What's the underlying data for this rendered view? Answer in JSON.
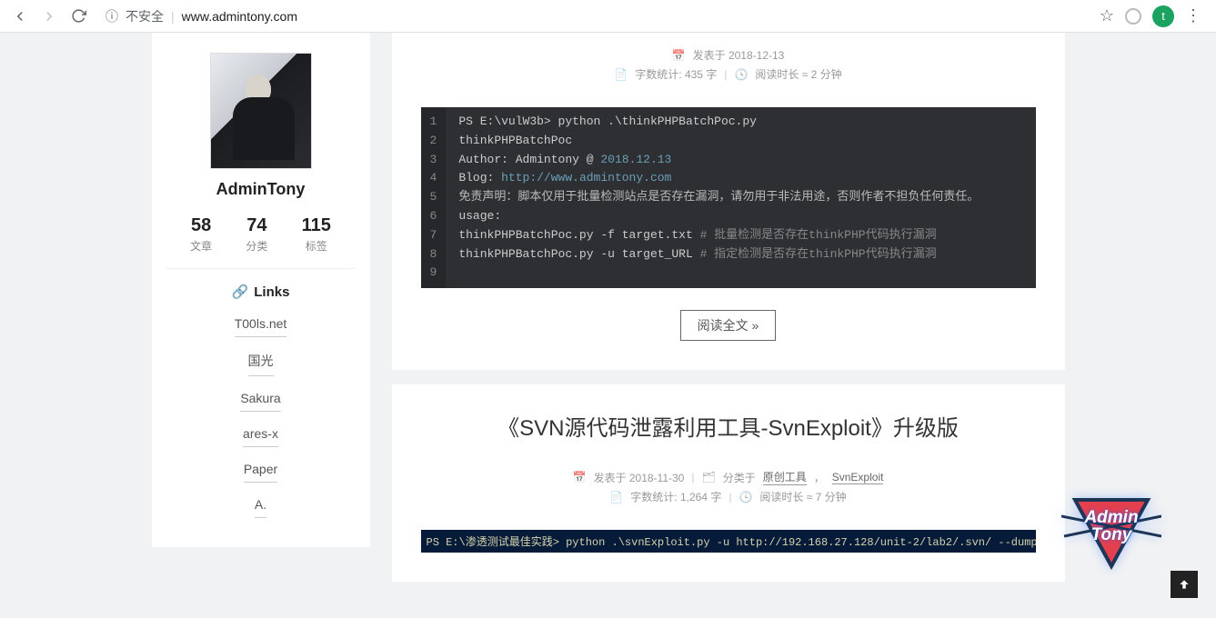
{
  "browser": {
    "insecure_label": "不安全",
    "url": "www.admintony.com",
    "avatar_letter": "t"
  },
  "sidebar": {
    "title": "AdminTony",
    "stats": [
      {
        "num": "58",
        "label": "文章"
      },
      {
        "num": "74",
        "label": "分类"
      },
      {
        "num": "115",
        "label": "标签"
      }
    ],
    "links_heading": "Links",
    "links": [
      "T00ls.net",
      "国光",
      "Sakura",
      "ares-x",
      "Paper",
      "A."
    ]
  },
  "post1": {
    "meta_posted_prefix": "发表于",
    "meta_date": "2018-12-13",
    "meta_wordcount": "字数统计: 435 字",
    "meta_readtime": "阅读时长 ≈ 2 分钟",
    "code_lines": [
      {
        "n": "1",
        "html": "PS E:\\vulW3b> python .\\thinkPHPBatchPoc.py"
      },
      {
        "n": "2",
        "html": "thinkPHPBatchPoc"
      },
      {
        "n": "3",
        "html": "Author: Admintony @ <span class='tok-date'>2018.12.13</span>"
      },
      {
        "n": "4",
        "html": "Blog: <span class='tok-url'>http://www.admintony.com</span>"
      },
      {
        "n": "5",
        "html": "<span class='tok-cn'>免责声明：脚本仅用于批量检测站点是否存在漏洞，请勿用于非法用途，否则作者不担负任何责任。</span>"
      },
      {
        "n": "6",
        "html": ""
      },
      {
        "n": "7",
        "html": "usage:"
      },
      {
        "n": "8",
        "html": "thinkPHPBatchPoc.py -f target.txt <span class='tok-cmt'># 批量检测是否存在thinkPHP代码执行漏洞</span>"
      },
      {
        "n": "9",
        "html": "thinkPHPBatchPoc.py -u target_URL <span class='tok-cmt'># 指定检测是否存在thinkPHP代码执行漏洞</span>"
      }
    ],
    "read_more": "阅读全文 »"
  },
  "post2": {
    "title": "《SVN源代码泄露利用工具-SvnExploit》升级版",
    "meta_posted_prefix": "发表于",
    "meta_date": "2018-11-30",
    "meta_cat_prefix": "分类于",
    "meta_cat1": "原创工具",
    "meta_cat2": "SvnExploit",
    "meta_wordcount": "字数统计: 1,264 字",
    "meta_readtime": "阅读时长 ≈ 7 分钟",
    "code_preview": "PS E:\\渗透测试最佳实践> python .\\svnExploit.py -u http://192.168.27.128/unit-2/lab2/.svn/ --dump"
  },
  "logo": {
    "line1": "Admin",
    "line2": "Tony"
  }
}
